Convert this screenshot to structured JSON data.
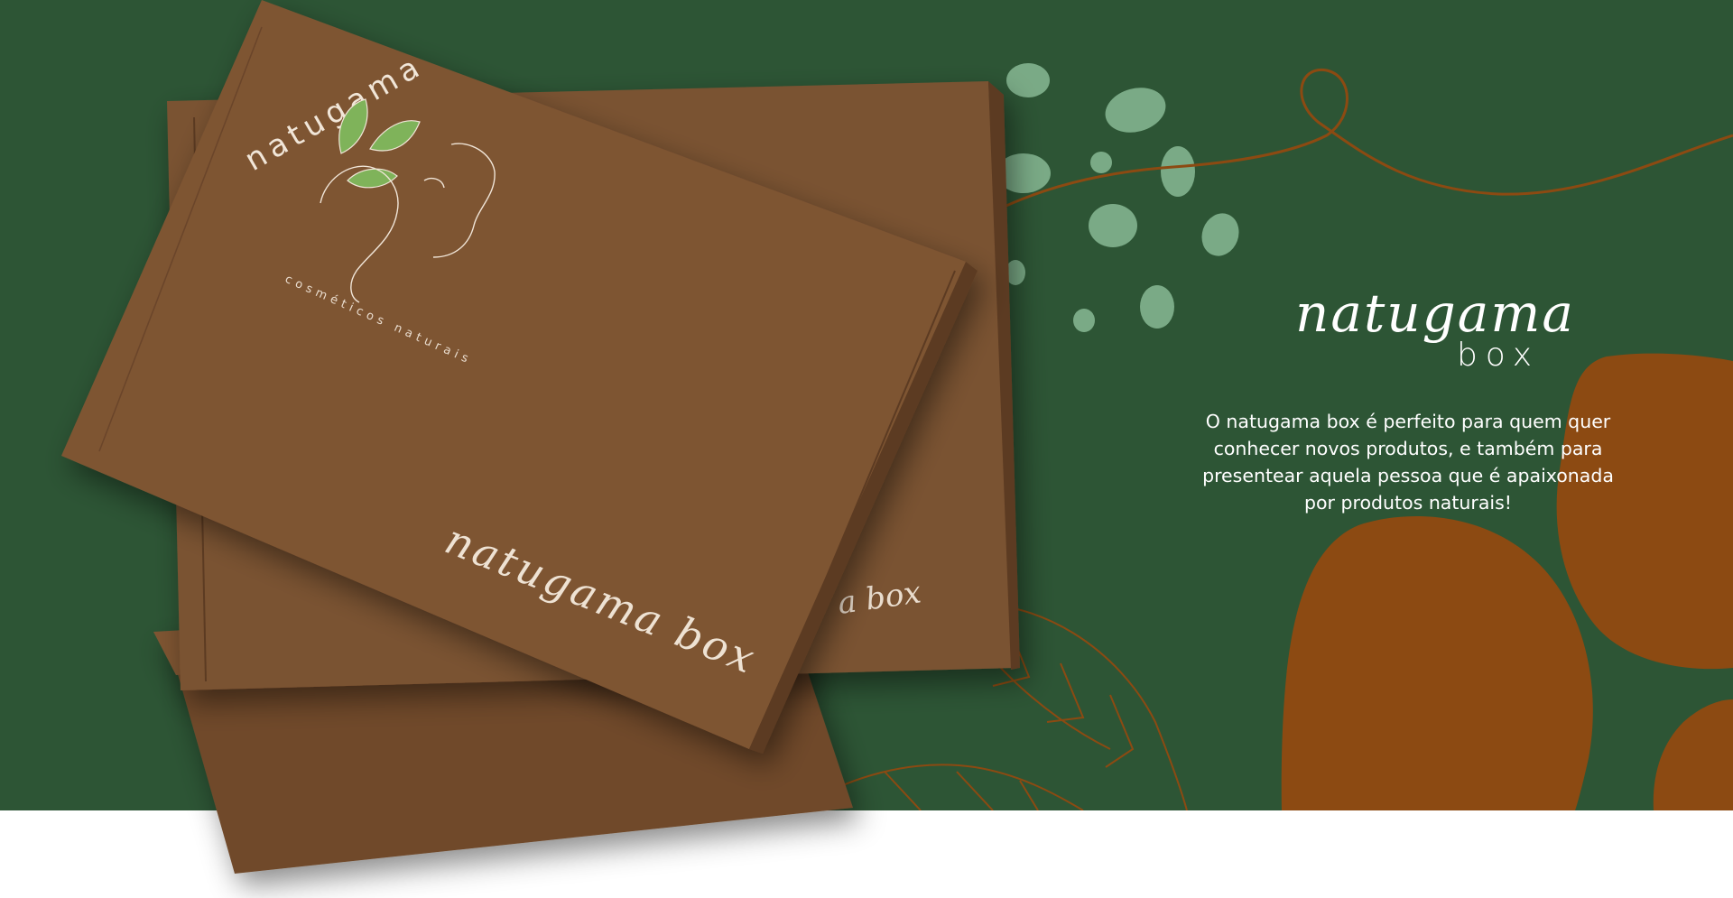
{
  "hero": {
    "colors": {
      "background": "#2d5535",
      "terracotta": "#8c4a12",
      "dot": "#7aaa86",
      "kraft": "#7e5433",
      "leaf_green": "#7fb35a",
      "white": "#ffffff"
    },
    "brand": {
      "name": "natugama",
      "sub": "box"
    },
    "description": "O natugama box é perfeito para quem quer conhecer novos produtos, e também para presentear aquela pessoa que é apaixonada por produtos naturais!"
  },
  "box_print": {
    "logo_name": "natugama",
    "logo_tagline": "cosméticos naturais",
    "front_script": "natugama box",
    "back_script": "a box"
  }
}
